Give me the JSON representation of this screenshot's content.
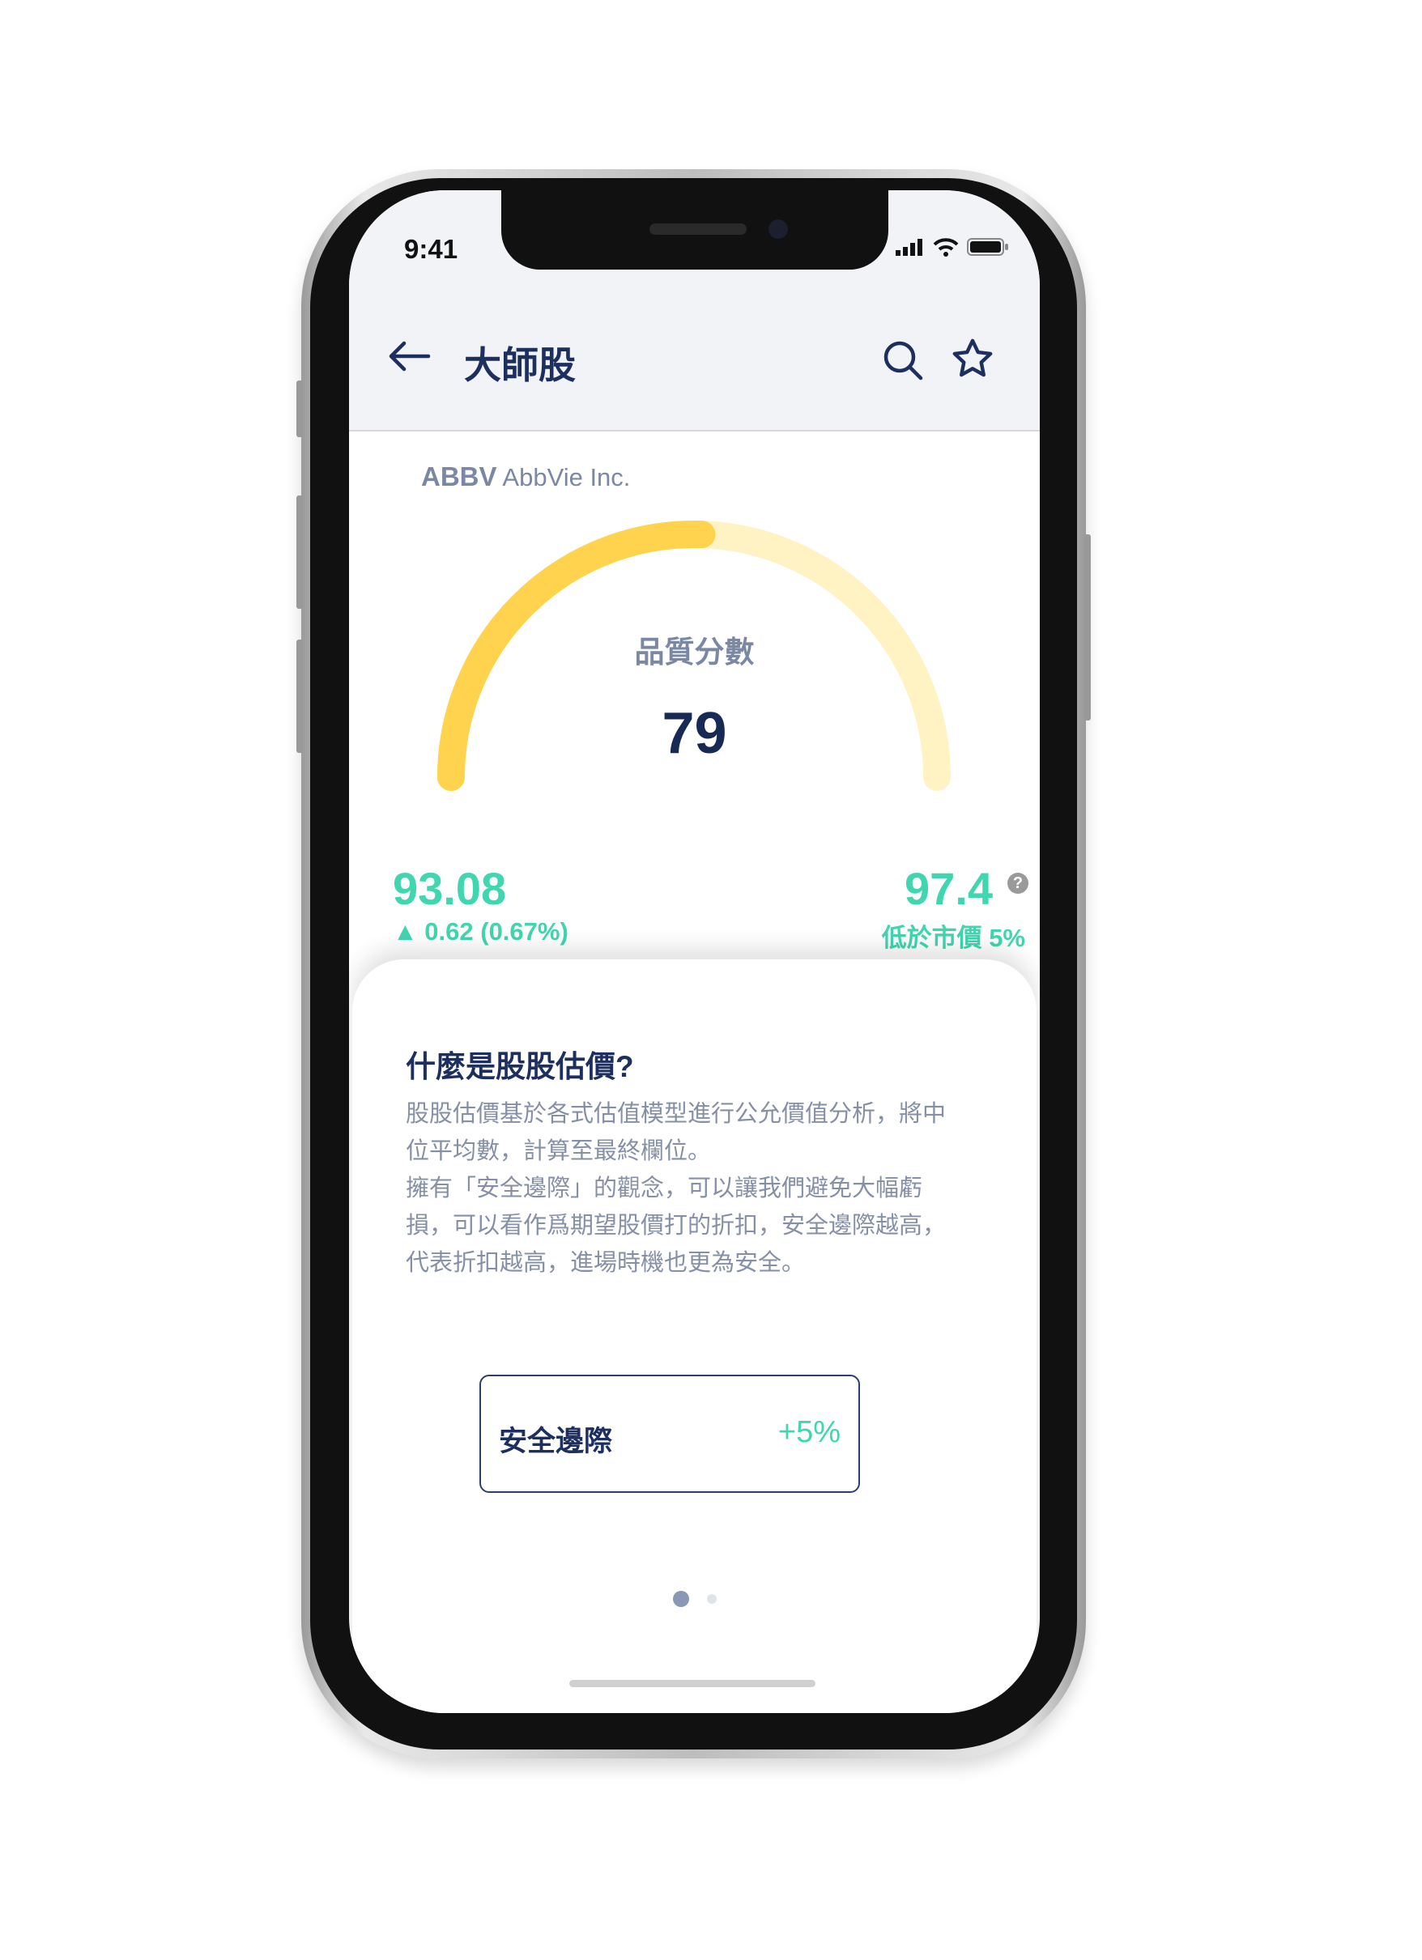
{
  "status_bar": {
    "time": "9:41"
  },
  "header": {
    "title": "大師股",
    "back_icon": "arrow-left-icon",
    "search_icon": "search-icon",
    "favorite_icon": "star-icon"
  },
  "stock": {
    "ticker": "ABBV",
    "name": "AbbVie Inc."
  },
  "gauge": {
    "label": "品質分數",
    "score": "79",
    "fill_fraction": 0.51,
    "color": "#ffd34e",
    "track_color": "#fff3c4"
  },
  "price": {
    "value": "93.08",
    "change": "▲ 0.62 (0.67%)"
  },
  "fair_value": {
    "value": "97.4",
    "help": "?",
    "note": "低於市價 5%"
  },
  "card": {
    "title": "什麼是股股估價?",
    "body": [
      "股股估價基於各式估值模型進行公允價值分析，將中",
      "位平均數，計算至最終欄位。",
      "擁有「安全邊際」的觀念，可以讓我們避免大幅虧",
      "損，可以看作爲期望股價打的折扣，安全邊際越高，",
      "代表折扣越高，進場時機也更為安全。"
    ],
    "margin_label": "安全邊際",
    "margin_value": "+5%"
  },
  "pager": {
    "current": 1,
    "total": 2
  },
  "colors": {
    "accent": "#40d6b0",
    "navy": "#1c2f5e"
  }
}
